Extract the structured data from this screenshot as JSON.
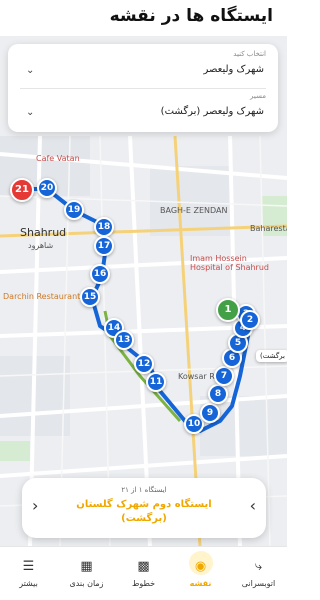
{
  "header": {
    "title": "ایستگاه ها در نقشه"
  },
  "selectors": {
    "line": {
      "caption": "انتخاب کنید",
      "value": "شهرک ولیعصر"
    },
    "route": {
      "caption": "مسیر",
      "value": "شهرک ولیعصر (برگشت)"
    },
    "chevron_icon": "chevron-down-icon"
  },
  "map": {
    "labels": {
      "cafe": "Cafe Vatan",
      "shahrud_en": "Shahrud",
      "shahrud_fa": "شاهرود",
      "bagh": "BAGH-E ZENDAN",
      "hospital": "Imam Hossein Hospital of Shahrud",
      "darchin": "Darchin Restaurant",
      "bahar": "Baharestan",
      "kowsar": "Kowsar Ru"
    },
    "stops": [
      "21",
      "20",
      "19",
      "18",
      "17",
      "16",
      "15",
      "14",
      "13",
      "12",
      "11",
      "10",
      "9",
      "8",
      "7",
      "6",
      "5",
      "4",
      "3",
      "2",
      "1"
    ],
    "return_tag": "برگشت)",
    "route_color": "#1565d8"
  },
  "info": {
    "count": "ایستگاه ۱ از ۲۱",
    "station": "ایستگاه دوم شهرک گلستان (برگشت)",
    "prev_icon": "chevron-right-icon",
    "next_icon": "chevron-left-icon"
  },
  "nav": {
    "tabs": [
      {
        "label": "اتوبسرانی",
        "icon": "route-icon"
      },
      {
        "label": "نقشه",
        "icon": "map-pin-icon",
        "active": true
      },
      {
        "label": "خطوط",
        "icon": "bus-icon"
      },
      {
        "label": "زمان بندی",
        "icon": "calendar-icon"
      },
      {
        "label": "بیشتر",
        "icon": "menu-icon"
      }
    ]
  },
  "colors": {
    "accent": "#f0a800",
    "route": "#1565d8",
    "start": "#e53935",
    "end": "#43a047"
  }
}
